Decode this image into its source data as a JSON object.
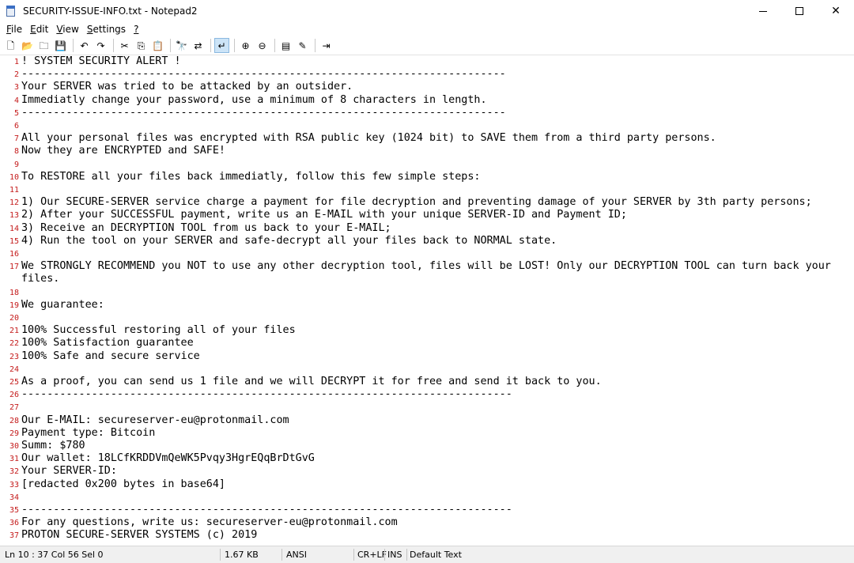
{
  "window": {
    "title": "SECURITY-ISSUE-INFO.txt - Notepad2",
    "minimize_glyph": "",
    "maximize_glyph": "",
    "close_glyph": "✕"
  },
  "menu": {
    "items": [
      {
        "key": "F",
        "rest": "ile"
      },
      {
        "key": "E",
        "rest": "dit"
      },
      {
        "key": "V",
        "rest": "iew"
      },
      {
        "key": "S",
        "rest": "ettings"
      },
      {
        "key": "?",
        "rest": ""
      }
    ]
  },
  "toolbar": {
    "buttons": [
      {
        "name": "new-file-icon",
        "glyph": "🗋"
      },
      {
        "name": "open-folder-icon",
        "glyph": "📂"
      },
      {
        "name": "browse-icon",
        "glyph": "🗀"
      },
      {
        "name": "save-icon",
        "glyph": "💾"
      },
      {
        "sep": true
      },
      {
        "name": "undo-icon",
        "glyph": "↶"
      },
      {
        "name": "redo-icon",
        "glyph": "↷"
      },
      {
        "sep": true
      },
      {
        "name": "cut-icon",
        "glyph": "✂"
      },
      {
        "name": "copy-icon",
        "glyph": "⎘"
      },
      {
        "name": "paste-icon",
        "glyph": "📋"
      },
      {
        "sep": true
      },
      {
        "name": "find-icon",
        "glyph": "🔭"
      },
      {
        "name": "replace-icon",
        "glyph": "⇄"
      },
      {
        "sep": true
      },
      {
        "name": "word-wrap-icon",
        "glyph": "↵",
        "active": true
      },
      {
        "sep": true
      },
      {
        "name": "zoom-in-icon",
        "glyph": "⊕"
      },
      {
        "name": "zoom-out-icon",
        "glyph": "⊖"
      },
      {
        "sep": true
      },
      {
        "name": "scheme-icon",
        "glyph": "▤"
      },
      {
        "name": "scheme-config-icon",
        "glyph": "✎"
      },
      {
        "sep": true
      },
      {
        "name": "exit-icon",
        "glyph": "⇥"
      }
    ]
  },
  "editor": {
    "line_number_color": "#c41a1a",
    "lines": [
      {
        "n": "1",
        "text": "! SYSTEM SECURITY ALERT !"
      },
      {
        "n": "2",
        "text": "----------------------------------------------------------------------------"
      },
      {
        "n": "3",
        "text": "Your SERVER was tried to be attacked by an outsider."
      },
      {
        "n": "4",
        "text": "Immediatly change your password, use a minimum of 8 characters in length."
      },
      {
        "n": "5",
        "text": "----------------------------------------------------------------------------"
      },
      {
        "n": "6",
        "text": ""
      },
      {
        "n": "7",
        "text": "All your personal files was encrypted with RSA public key (1024 bit) to SAVE them from a third party persons."
      },
      {
        "n": "8",
        "text": "Now they are ENCRYPTED and SAFE!"
      },
      {
        "n": "9",
        "text": ""
      },
      {
        "n": "10",
        "text": "To RESTORE all your files back immediatly, follow this few simple steps:"
      },
      {
        "n": "11",
        "text": ""
      },
      {
        "n": "12",
        "text": "1) Our SECURE-SERVER service charge a payment for file decryption and preventing damage of your SERVER by 3th party persons;"
      },
      {
        "n": "13",
        "text": "2) After your SUCCESSFUL payment, write us an E-MAIL with your unique SERVER-ID and Payment ID;"
      },
      {
        "n": "14",
        "text": "3) Receive an DECRYPTION TOOL from us back to your E-MAIL;"
      },
      {
        "n": "15",
        "text": "4) Run the tool on your SERVER and safe-decrypt all your files back to NORMAL state."
      },
      {
        "n": "16",
        "text": ""
      },
      {
        "n": "17",
        "text": "We STRONGLY RECOMMEND you NOT to use any other decryption tool, files will be LOST! Only our DECRYPTION TOOL can turn back your"
      },
      {
        "n": "",
        "text": "files."
      },
      {
        "n": "18",
        "text": ""
      },
      {
        "n": "19",
        "text": "We guarantee:"
      },
      {
        "n": "20",
        "text": ""
      },
      {
        "n": "21",
        "text": "100% Successful restoring all of your files"
      },
      {
        "n": "22",
        "text": "100% Satisfaction guarantee"
      },
      {
        "n": "23",
        "text": "100% Safe and secure service"
      },
      {
        "n": "24",
        "text": ""
      },
      {
        "n": "25",
        "text": "As a proof, you can send us 1 file and we will DECRYPT it for free and send it back to you."
      },
      {
        "n": "26",
        "text": "-----------------------------------------------------------------------------"
      },
      {
        "n": "27",
        "text": ""
      },
      {
        "n": "28",
        "text": "Our E-MAIL: secureserver-eu@protonmail.com"
      },
      {
        "n": "29",
        "text": "Payment type: Bitcoin"
      },
      {
        "n": "30",
        "text": "Summ: $780"
      },
      {
        "n": "31",
        "text": "Our wallet: 18LCfKRDDVmQeWK5Pvqy3HgrEQqBrDtGvG"
      },
      {
        "n": "32",
        "text": "Your SERVER-ID:"
      },
      {
        "n": "33",
        "text": "[redacted 0x200 bytes in base64]"
      },
      {
        "n": "34",
        "text": ""
      },
      {
        "n": "35",
        "text": "-----------------------------------------------------------------------------"
      },
      {
        "n": "36",
        "text": "For any questions, write us: secureserver-eu@protonmail.com"
      },
      {
        "n": "37",
        "text": "PROTON SECURE-SERVER SYSTEMS (c) 2019"
      }
    ]
  },
  "statusbar": {
    "position": "Ln 10 : 37   Col 56   Sel 0",
    "size": "1.67 KB",
    "encoding": "ANSI",
    "line_endings": "CR+LF",
    "mode": "INS",
    "scheme": "Default Text"
  }
}
